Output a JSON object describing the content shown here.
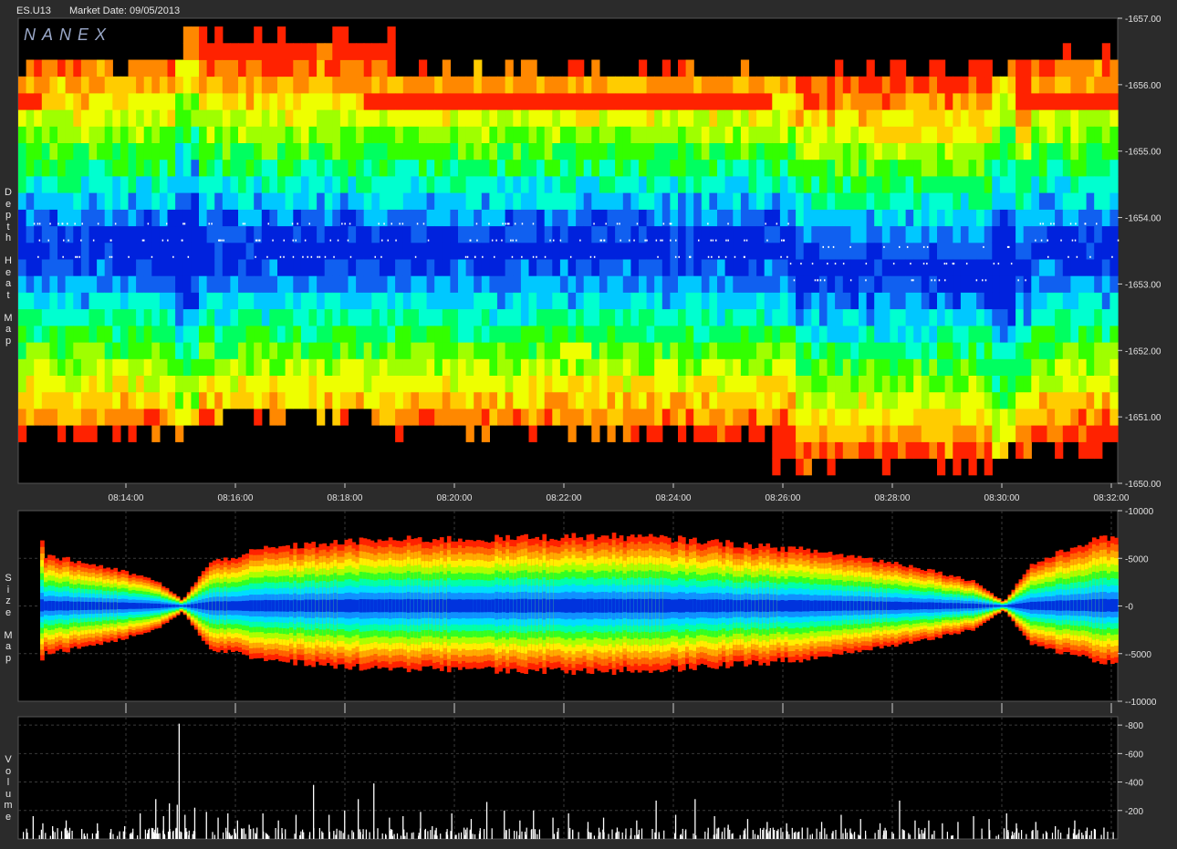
{
  "header": {
    "symbol": "ES.U13",
    "market_date": "Market Date: 09/05/2013"
  },
  "logo": "NANEX",
  "panels": {
    "depth": {
      "label": "Depth Heat Map"
    },
    "size": {
      "label": "Size Map"
    },
    "volume": {
      "label": "Volume"
    }
  },
  "colors": {
    "background": "#000000",
    "frame": "#2b2b2b",
    "grid": "#3a3a3a",
    "heat_scale": [
      "#0022dd",
      "#1060f0",
      "#00c8ff",
      "#00ffd0",
      "#00ff60",
      "#33ff00",
      "#9fff00",
      "#eeff00",
      "#ffcc00",
      "#ff8800",
      "#ff2200"
    ],
    "volume_bar": "#ffffff"
  },
  "chart_data": [
    {
      "type": "heatmap",
      "name": "Depth Heat Map",
      "x_ticks": [
        "08:14:00",
        "08:16:00",
        "08:18:00",
        "08:20:00",
        "08:22:00",
        "08:24:00",
        "08:26:00",
        "08:28:00",
        "08:30:00",
        "08:32:00"
      ],
      "x_range_minutes": [
        8.2167,
        8.5383
      ],
      "y_ticks": [
        "1657.00",
        "1656.00",
        "1655.00",
        "1654.00",
        "1653.00",
        "1652.00",
        "1651.00",
        "1650.00"
      ],
      "ylim": [
        1650.0,
        1657.0
      ],
      "tick_size": 0.25,
      "description_levels": "inside market (around 1653.50) shows low depth (blue), outer levels show high depth (green to red); high-depth band near 1655.75 on ask"
    },
    {
      "type": "area",
      "name": "Size Map",
      "y_ticks": [
        "10000",
        "5000",
        "0",
        "-5000",
        "-10000"
      ],
      "ylim": [
        -10000,
        10000
      ],
      "x": [
        "08:12:30",
        "08:13:30",
        "08:14:30",
        "08:15:00",
        "08:15:30",
        "08:16:30",
        "08:17:30",
        "08:18:30",
        "08:19:30",
        "08:20:30",
        "08:21:30",
        "08:22:30",
        "08:23:30",
        "08:24:30",
        "08:25:30",
        "08:26:30",
        "08:27:30",
        "08:28:30",
        "08:29:30",
        "08:30:00",
        "08:30:30",
        "08:31:30",
        "08:32:00"
      ],
      "upper": [
        5300,
        4200,
        2700,
        600,
        4500,
        6000,
        6500,
        6900,
        7000,
        7000,
        7200,
        7300,
        7200,
        6800,
        6300,
        5800,
        5000,
        4000,
        2500,
        400,
        4300,
        6700,
        7200
      ],
      "lower": [
        -5000,
        -4000,
        -2500,
        -600,
        -4500,
        -5500,
        -6200,
        -6500,
        -6600,
        -6700,
        -6800,
        -6900,
        -6700,
        -6400,
        -6000,
        -5500,
        -4600,
        -3700,
        -2400,
        -400,
        -4000,
        -5500,
        -6000
      ]
    },
    {
      "type": "bar",
      "name": "Volume",
      "y_ticks": [
        "800",
        "600",
        "400",
        "200"
      ],
      "ylim": [
        0,
        820
      ],
      "spikes": [
        {
          "t": 0.05,
          "v": 160
        },
        {
          "t": 0.1,
          "v": 110
        },
        {
          "t": 0.15,
          "v": 90
        },
        {
          "t": 0.22,
          "v": 130
        },
        {
          "t": 0.3,
          "v": 70
        },
        {
          "t": 0.38,
          "v": 110
        },
        {
          "t": 0.45,
          "v": 70
        },
        {
          "t": 0.52,
          "v": 90
        },
        {
          "t": 0.6,
          "v": 180
        },
        {
          "t": 0.68,
          "v": 280
        },
        {
          "t": 0.72,
          "v": 160
        },
        {
          "t": 0.75,
          "v": 250
        },
        {
          "t": 0.79,
          "v": 240
        },
        {
          "t": 0.8,
          "v": 810
        },
        {
          "t": 0.83,
          "v": 170
        },
        {
          "t": 0.88,
          "v": 220
        },
        {
          "t": 0.94,
          "v": 190
        },
        {
          "t": 1.0,
          "v": 150
        },
        {
          "t": 1.05,
          "v": 180
        },
        {
          "t": 1.1,
          "v": 130
        },
        {
          "t": 1.16,
          "v": 100
        },
        {
          "t": 1.23,
          "v": 180
        },
        {
          "t": 1.31,
          "v": 130
        },
        {
          "t": 1.4,
          "v": 170
        },
        {
          "t": 1.49,
          "v": 380
        },
        {
          "t": 1.57,
          "v": 170
        },
        {
          "t": 1.65,
          "v": 200
        },
        {
          "t": 1.72,
          "v": 280
        },
        {
          "t": 1.8,
          "v": 390
        },
        {
          "t": 1.88,
          "v": 150
        },
        {
          "t": 1.95,
          "v": 160
        },
        {
          "t": 2.04,
          "v": 190
        },
        {
          "t": 2.1,
          "v": 90
        },
        {
          "t": 2.2,
          "v": 180
        },
        {
          "t": 2.3,
          "v": 140
        },
        {
          "t": 2.38,
          "v": 260
        },
        {
          "t": 2.47,
          "v": 200
        },
        {
          "t": 2.55,
          "v": 130
        },
        {
          "t": 2.62,
          "v": 200
        },
        {
          "t": 2.72,
          "v": 150
        },
        {
          "t": 2.8,
          "v": 180
        },
        {
          "t": 2.9,
          "v": 120
        },
        {
          "t": 2.98,
          "v": 150
        },
        {
          "t": 3.05,
          "v": 80
        },
        {
          "t": 3.15,
          "v": 130
        },
        {
          "t": 3.25,
          "v": 270
        },
        {
          "t": 3.35,
          "v": 170
        },
        {
          "t": 3.45,
          "v": 280
        },
        {
          "t": 3.55,
          "v": 160
        },
        {
          "t": 3.62,
          "v": 100
        },
        {
          "t": 3.72,
          "v": 140
        },
        {
          "t": 3.82,
          "v": 120
        },
        {
          "t": 3.92,
          "v": 110
        },
        {
          "t": 4.0,
          "v": 80
        },
        {
          "t": 4.1,
          "v": 120
        },
        {
          "t": 4.2,
          "v": 170
        },
        {
          "t": 4.3,
          "v": 140
        },
        {
          "t": 4.4,
          "v": 110
        },
        {
          "t": 4.5,
          "v": 270
        },
        {
          "t": 4.58,
          "v": 130
        },
        {
          "t": 4.65,
          "v": 130
        },
        {
          "t": 4.72,
          "v": 110
        },
        {
          "t": 4.8,
          "v": 120
        },
        {
          "t": 4.88,
          "v": 160
        },
        {
          "t": 4.96,
          "v": 140
        },
        {
          "t": 5.05,
          "v": 180
        },
        {
          "t": 5.1,
          "v": 110
        },
        {
          "t": 5.2,
          "v": 120
        },
        {
          "t": 5.3,
          "v": 90
        },
        {
          "t": 5.4,
          "v": 130
        },
        {
          "t": 5.55,
          "v": 80
        }
      ]
    }
  ]
}
